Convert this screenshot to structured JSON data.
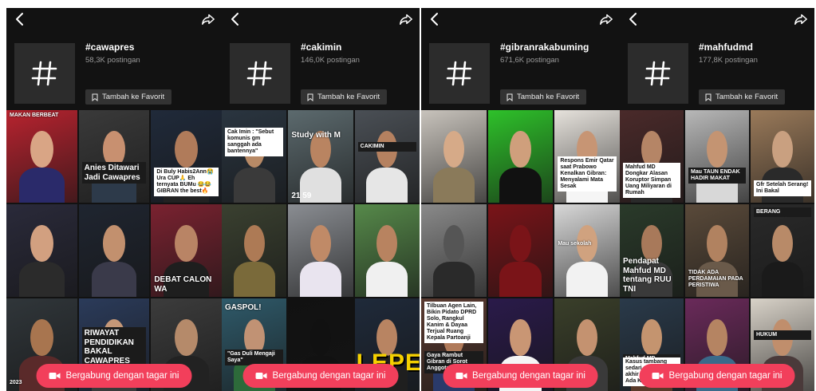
{
  "panels": [
    {
      "tag": "#cawapres",
      "posts": "58,3K postingan",
      "fav": "Tambah ke Favorit",
      "join": "Bergabung dengan tagar ini",
      "tiles": [
        {
          "bg": "#b8232f",
          "skin": "#d9a585",
          "shirt": "#2a2a6a",
          "caps": [
            {
              "text": "MAKAN BERBEAT",
              "cls": "plain",
              "pos": "top:3px;"
            }
          ]
        },
        {
          "bg": "#3a3a3a",
          "skin": "#c89070",
          "shirt": "#2d3a4a",
          "caps": [
            {
              "text": "Anies Ditawari Jadi Cawapres",
              "cls": "dark big",
              "pos": "bottom:24px;"
            }
          ]
        },
        {
          "bg": "#202a3a",
          "skin": "#b07b5a",
          "shirt": "#222222",
          "caps": [
            {
              "text": "Di Buly Habis2Ann😭Ura CUP🙏 Eh ternyata BUMu 😂😂 GIBRAN the best🔥",
              "cls": "light",
              "pos": "bottom:8px;"
            }
          ]
        },
        {
          "bg": "#2a2a3a",
          "skin": "#d2a080",
          "shirt": "#2b2b2b",
          "caps": []
        },
        {
          "bg": "#1f2530",
          "skin": "#c2906e",
          "shirt": "#3a3a4a",
          "caps": []
        },
        {
          "bg": "#7a2230",
          "skin": "#b98465",
          "shirt": "#1e1e1e",
          "caps": [
            {
              "text": "DEBAT CALON WA",
              "cls": "plain big",
              "pos": "bottom:4px;"
            }
          ]
        },
        {
          "bg": "#30363a",
          "skin": "#a8754f",
          "shirt": "#5a2a2a",
          "caps": [
            {
              "text": "2023",
              "cls": "plain",
              "pos": "bottom:6px;"
            }
          ]
        },
        {
          "bg": "#2b3b5a",
          "skin": "#c59878",
          "shirt": "#3a3a3a",
          "caps": [
            {
              "text": "RIWAYAT PENDIDIKAN BAKAL CAWAPRES GANJAR PRANOWO",
              "cls": "dark big",
              "pos": "top:36px;"
            }
          ]
        },
        {
          "bg": "#3c3c3c",
          "skin": "#b58a6a",
          "shirt": "#222222",
          "caps": []
        }
      ]
    },
    {
      "tag": "#cakimin",
      "posts": "146,0K postingan",
      "fav": "Tambah ke Favorit",
      "join": "Bergabung dengan tagar ini",
      "tiles": [
        {
          "bg": "#2a3540",
          "skin": "#b88a66",
          "shirt": "#3a3a3a",
          "caps": [
            {
              "text": "Cak Imin : \"Sebut komunis gm sanggah ada bantennya\"",
              "cls": "light",
              "pos": "top:22px;"
            }
          ]
        },
        {
          "bg": "#5c6a6e",
          "skin": "#b98461",
          "shirt": "#e0e0e0",
          "caps": [
            {
              "text": "Study with M",
              "cls": "plain big",
              "pos": "top:26px;"
            }
          ],
          "ts": "21 59"
        },
        {
          "bg": "#4a4f55",
          "skin": "#b58160",
          "shirt": "#e6e6e6",
          "caps": [
            {
              "text": "CAKIMIN",
              "cls": "dark",
              "pos": "top:40px;"
            }
          ]
        },
        {
          "bg": "#3a4030",
          "skin": "#ad7a55",
          "shirt": "#7a6a3a",
          "caps": []
        },
        {
          "bg": "#8a8d92",
          "skin": "#c08a67",
          "shirt": "#e9e4ef",
          "caps": []
        },
        {
          "bg": "#56894a",
          "skin": "#b88360",
          "shirt": "#f0f0f0",
          "caps": []
        },
        {
          "bg": "#2f5a6a",
          "skin": "#c19274",
          "shirt": "#2d6a3a",
          "caps": [
            {
              "text": "GASPOL!",
              "cls": "plain big",
              "pos": "top:6px;"
            },
            {
              "text": "\"Gas Duli Mengaji Saya\"",
              "cls": "dark",
              "pos": "bottom:32px;"
            }
          ]
        },
        {
          "bg": "#111111",
          "skin": "#111111",
          "shirt": "#111111",
          "caps": []
        },
        {
          "bg": "#1f2a3a",
          "skin": "#b88462",
          "shirt": "#1f1f1f",
          "caps": [
            {
              "text": "LEPE",
              "cls": "huge",
              "pos": "bottom:18px;"
            }
          ]
        }
      ]
    },
    {
      "tag": "#gibranrakabuming",
      "posts": "671,6K postingan",
      "fav": "Tambah ke Favorit",
      "join": "Bergabung dengan tagar ini",
      "tiles": [
        {
          "bg": "#c8c3bc",
          "skin": "#d6aa88",
          "shirt": "#8a7a5a",
          "caps": []
        },
        {
          "bg": "#2ec12a",
          "skin": "#cf9f7c",
          "shirt": "#111111",
          "caps": []
        },
        {
          "bg": "#e6e2dc",
          "skin": "#c79574",
          "shirt": "#f5f5f5",
          "caps": [
            {
              "text": "Respons Emir Qatar saat Prabowo Kenalkan Gibran: Menyalami Mata Sesak",
              "cls": "light",
              "pos": "bottom:14px;"
            }
          ]
        },
        {
          "bg": "#8a8a8a",
          "skin": "#555555",
          "shirt": "#2a2a2a",
          "caps": []
        },
        {
          "bg": "#7a1418",
          "skin": "#7a1418",
          "shirt": "#7a1418",
          "caps": []
        },
        {
          "bg": "#d8d8d8",
          "skin": "#d0a27f",
          "shirt": "#f2f2f2",
          "caps": [
            {
              "text": "Mau sekolah",
              "cls": "plain",
              "pos": "top:46px;"
            }
          ]
        },
        {
          "bg": "#5a3a30",
          "skin": "#b07a5a",
          "shirt": "#2a3a6a",
          "caps": [
            {
              "text": "Tilbuan Agen Lain, Bikin Pidato DPRD Solo, Rangkul Kanim & Dayaa Terjual Ruang Kepala Partoanji",
              "cls": "light",
              "pos": "top:4px;"
            },
            {
              "text": "Gaya Rambut Gibran di Sorot Anggota DPRD",
              "cls": "dark",
              "pos": "bottom:22px;"
            }
          ]
        },
        {
          "bg": "#2a1a4a",
          "skin": "#c99674",
          "shirt": "#f5f5f5",
          "caps": []
        },
        {
          "bg": "#3a3f2a",
          "skin": "#c49270",
          "shirt": "#3a3a3a",
          "caps": []
        }
      ]
    },
    {
      "tag": "#mahfudmd",
      "posts": "177,8K postingan",
      "fav": "Tambah ke Favorit",
      "join": "Bergabung dengan tagar ini",
      "tiles": [
        {
          "bg": "#4a2a2a",
          "skin": "#b58566",
          "shirt": "#2a2a2a",
          "caps": [
            {
              "text": "Mahfud MD Dongkar Alasan Koruptor Simpan Uang Miliyaran di Rumah",
              "cls": "light",
              "pos": "bottom:6px;"
            }
          ]
        },
        {
          "bg": "#b8b8b8",
          "skin": "#c49472",
          "shirt": "#d8d8d8",
          "caps": [
            {
              "text": "Mau TAUN ENDAK HADIR MAKAT",
              "cls": "dark",
              "pos": "bottom:24px;"
            }
          ]
        },
        {
          "bg": "#9a7a5a",
          "skin": "#c9a080",
          "shirt": "#2a2a2a",
          "caps": [
            {
              "text": "Gfr Setelah Serang! Ini Bakal",
              "cls": "light",
              "pos": "bottom:8px;"
            }
          ]
        },
        {
          "bg": "#2a3a2a",
          "skin": "#a8795a",
          "shirt": "#3a3a3a",
          "caps": [
            {
              "text": "Pendapat Mahfud MD tentang RUU TNI",
              "cls": "plain big",
              "pos": "bottom:4px;"
            }
          ]
        },
        {
          "bg": "#5a4a3a",
          "skin": "#b18260",
          "shirt": "#6a5a4a",
          "caps": [
            {
              "text": "TIDAK ADA PERDAMAIAN PADA PERISTIWA",
              "cls": "plain",
              "pos": "bottom:10px;"
            }
          ]
        },
        {
          "bg": "#2a2a2a",
          "skin": "#b88a68",
          "shirt": "#1a1a1a",
          "caps": [
            {
              "text": "BERANG",
              "cls": "dark",
              "pos": "top:4px;"
            }
          ]
        },
        {
          "bg": "#2a3a4a",
          "skin": "#c4946f",
          "shirt": "#5a3a2a",
          "caps": [
            {
              "text": "Mahfud MD",
              "cls": "dark",
              "pos": "bottom:34px;"
            },
            {
              "text": "Kasus tambang sedari mulai hingga akhir dan Tidak Ada Kebenaran",
              "cls": "light",
              "pos": "bottom:6px;"
            }
          ]
        },
        {
          "bg": "#6a2a5a",
          "skin": "#b58462",
          "shirt": "#3a6a8a",
          "caps": []
        },
        {
          "bg": "#d8d2c8",
          "skin": "#c08e6c",
          "shirt": "#4a3a3a",
          "caps": [
            {
              "text": "HUKUM",
              "cls": "dark",
              "pos": "top:40px;"
            }
          ]
        }
      ]
    }
  ]
}
